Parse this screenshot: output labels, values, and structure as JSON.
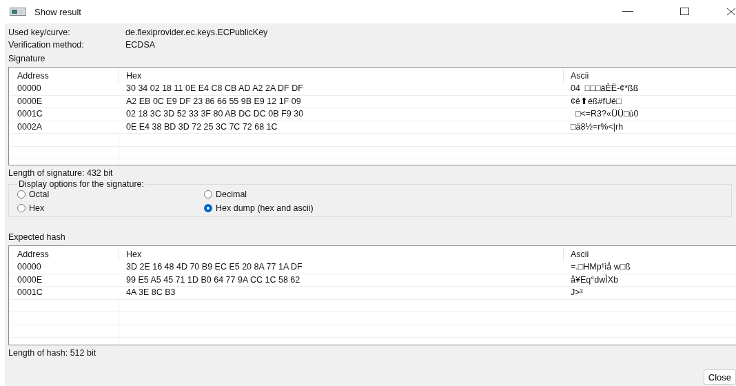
{
  "window": {
    "title": "Show result"
  },
  "info": [
    {
      "label": "Used key/curve:",
      "value": "de.flexiprovider.ec.keys.ECPublicKey"
    },
    {
      "label": "Verification method:",
      "value": "ECDSA"
    }
  ],
  "signature": {
    "heading": "Signature",
    "columns": [
      "Address",
      "Hex",
      "Ascii"
    ],
    "rows": [
      [
        "00000",
        "30 34 02 18 11 0E E4 C8 CB AD A2 2A DF DF",
        "04  □□□äÈË-¢*ßß"
      ],
      [
        "0000E",
        "A2 EB 0C E9 DF 23 86 66 55 9B E9 12 1F 09",
        "¢ë⬆éß#fUé□"
      ],
      [
        "0001C",
        "02 18 3C 3D 52 33 3F 80 AB DC DC 0B F9 30",
        "  □<=R3?«ÜÜ□ù0"
      ],
      [
        "0002A",
        "0E E4 38 BD 3D 72 25 3C 7C 72 68 1C",
        "□ä8½=r%<|rh"
      ]
    ],
    "length": "Length of signature: 432 bit"
  },
  "display_options": {
    "legend": "Display options for the signature:",
    "options": [
      {
        "label": "Octal",
        "selected": false
      },
      {
        "label": "Decimal",
        "selected": false
      },
      {
        "label": "Hex",
        "selected": false
      },
      {
        "label": "Hex dump (hex and ascii)",
        "selected": true
      }
    ]
  },
  "hash": {
    "heading": "Expected hash",
    "columns": [
      "Address",
      "Hex",
      "Ascii"
    ],
    "rows": [
      [
        "00000",
        "3D 2E 16 48 4D 70 B9 EC E5 20 8A 77 1A DF",
        "=.□HMp¹ìå w□ß"
      ],
      [
        "0000E",
        "99 E5 A5 45 71 1D B0 64 77 9A CC 1C 58 62",
        "å¥Eq°dwÌXb"
      ],
      [
        "0001C",
        "4A 3E 8C B3",
        "J>³"
      ]
    ],
    "length": "Length of hash: 512 bit"
  },
  "buttons": [
    "Close"
  ]
}
